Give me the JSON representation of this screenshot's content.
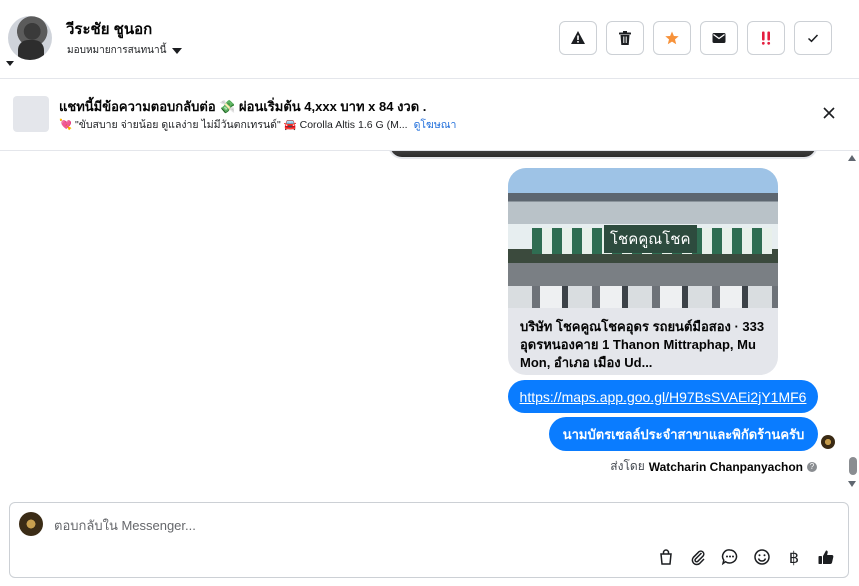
{
  "header": {
    "name": "วีระชัย ชูนอก",
    "assigned_label": "มอบหมายการสนทนานี้",
    "actions": [
      {
        "icon": "warning-icon"
      },
      {
        "icon": "trash-icon"
      },
      {
        "icon": "star-icon",
        "color": "#f7923a"
      },
      {
        "icon": "mail-icon"
      },
      {
        "icon": "priority-icon",
        "color": "#e41e3f"
      },
      {
        "icon": "check-icon"
      }
    ]
  },
  "ad": {
    "title": "แชทนี้มีข้อความตอบกลับต่อ 💸 ผ่อนเริ่มต้น 4,xxx บาท x 84 งวด .",
    "subtitle": "💘 \"ขับสบาย จ่ายน้อย ดูแลง่าย ไม่มีวันตกเทรนด์\" 🚘 Corolla Altis 1.6 G (M...",
    "link": "ดูโฆษณา"
  },
  "chat": {
    "card_image_sign": "โชคคูณโชค",
    "card_text": "บริษัท โชคคูณโชคอุดร รถยนต์มือสอง · 333 อุดรหนองคาย 1 Thanon Mittraphap, Mu Mon, อำเภอ เมือง Ud...",
    "link_message": "https://maps.app.goo.gl/H97BsSVAEi2jY1MF6",
    "text_message": "นามบัตรเซลล์ประจำสาขาและพิกัดร้านครับ",
    "sent_by_prefix": "ส่งโดย",
    "sent_by_name": "Watcharin Chanpanyachon"
  },
  "composer": {
    "placeholder": "ตอบกลับใน Messenger...",
    "baht_symbol": "฿",
    "tools": [
      "shopping-bag-icon",
      "attachment-icon",
      "chat-bubble-icon",
      "emoji-icon",
      "baht-icon",
      "thumbs-up-icon"
    ]
  }
}
